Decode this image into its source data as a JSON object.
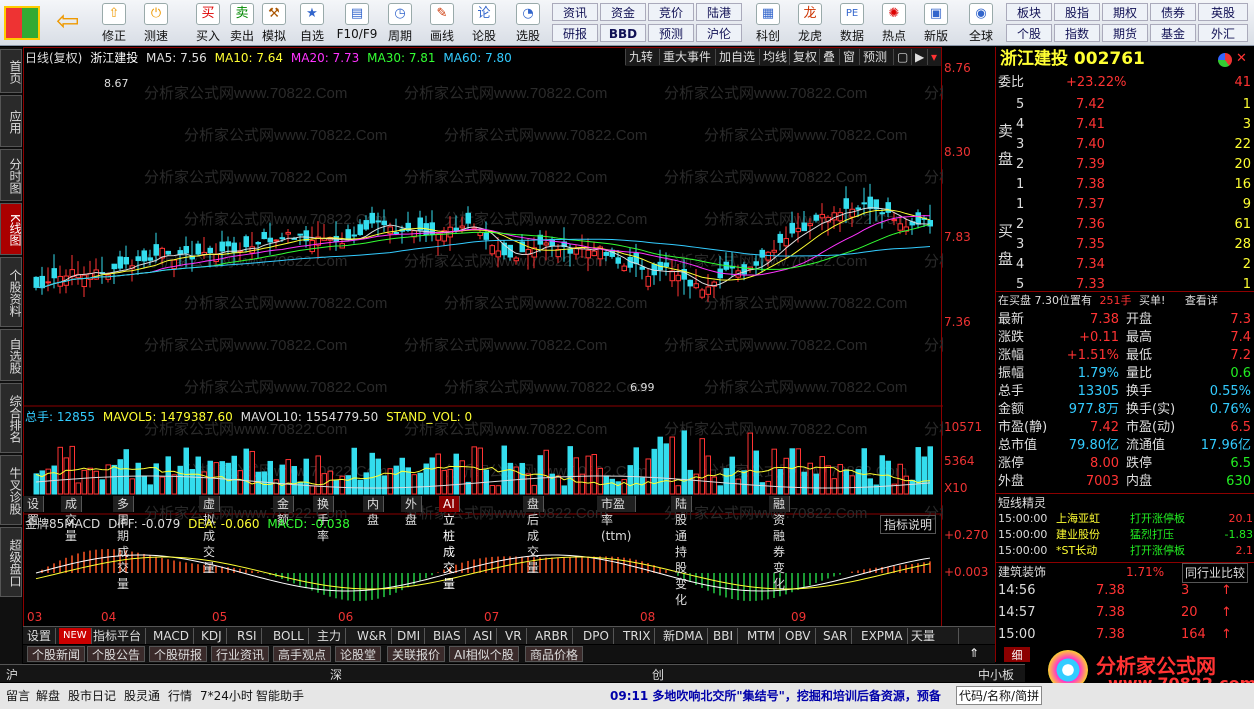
{
  "toolbar": {
    "buttons": [
      "修正",
      "测速",
      "买入",
      "卖出",
      "模拟",
      "自选",
      "F10/F9",
      "周期",
      "画线",
      "论股",
      "选股",
      "科创",
      "龙虎",
      "数据",
      "热点",
      "新版",
      "全球"
    ],
    "small_top": [
      "资讯",
      "资金",
      "竞价",
      "陆港"
    ],
    "small_bottom": [
      "研报",
      "BBD",
      "预测",
      "沪伦"
    ],
    "right_top": [
      "板块",
      "股指",
      "期权",
      "债券",
      "英股"
    ],
    "right_bottom": [
      "个股",
      "指数",
      "期货",
      "基金",
      "外汇"
    ]
  },
  "lefttabs": [
    "首页",
    "应用",
    "分时图",
    "K线图",
    "个股资料",
    "自选股",
    "综合排名",
    "牛叉诊股",
    "超级盘口"
  ],
  "chart_header": {
    "period": "日线(复权)",
    "name": "浙江建投",
    "ma5": "MA5: 7.56",
    "ma10": "MA10: 7.64",
    "ma20": "MA20: 7.73",
    "ma30": "MA30: 7.81",
    "ma60": "MA60: 7.80"
  },
  "chart_buttons": [
    "九转",
    "重大事件",
    "加自选",
    "均线",
    "复权",
    "叠",
    "窗",
    "预测"
  ],
  "price_axis": [
    "8.76",
    "8.30",
    "7.83",
    "7.36"
  ],
  "price_marks": {
    "high": "8.67",
    "low": "6.99"
  },
  "vol_header": {
    "total": "总手: 12855",
    "mavol5": "MAVOL5: 1479387.60",
    "mavol10": "MAVOL10: 1554779.50",
    "stand": "STAND_VOL: 0"
  },
  "vol_axis": [
    "10571",
    "5364",
    "X10"
  ],
  "bottom_tabs": [
    "设置",
    "成交量",
    "多周期成交量",
    "虚拟成交量",
    "金额",
    "换手率",
    "内盘",
    "外盘",
    "AI立桩成交量",
    "盘后成交量",
    "市盈率(ttm)",
    "陆股通持股变化",
    "融资融券变化"
  ],
  "macd_header": {
    "name": "金牌85MACD",
    "diff": "DIFF: -0.079",
    "dea": "DEA: -0.060",
    "macd": "MACD: -0.038",
    "help": "指标说明"
  },
  "macd_axis": [
    "+0.270",
    "+0.003"
  ],
  "months": [
    "03",
    "04",
    "05",
    "06",
    "07",
    "08",
    "09"
  ],
  "indicator_tabs": [
    "设置",
    "NEW",
    "指标平台",
    "MACD",
    "KDJ",
    "RSI",
    "BOLL",
    "主力",
    "W&R",
    "DMI",
    "BIAS",
    "ASI",
    "VR",
    "ARBR",
    "DPO",
    "TRIX",
    "新DMA",
    "BBI",
    "MTM",
    "OBV",
    "SAR",
    "EXPMA",
    "天量和..."
  ],
  "sub_tabs": [
    "个股新闻",
    "个股公告",
    "个股研报",
    "行业资讯",
    "高手观点",
    "论股堂",
    "关联报价",
    "AI相似个股",
    "商品价格"
  ],
  "quote": {
    "title": "浙江建投 002761",
    "weibi_label": "委比",
    "weibi": "+23.22%",
    "weicha": "41",
    "sell": [
      [
        "5",
        "7.42",
        "1"
      ],
      [
        "4",
        "7.41",
        "3"
      ],
      [
        "3",
        "7.40",
        "22"
      ],
      [
        "2",
        "7.39",
        "20"
      ],
      [
        "1",
        "7.38",
        "16"
      ]
    ],
    "buy": [
      [
        "1",
        "7.37",
        "9"
      ],
      [
        "2",
        "7.36",
        "61"
      ],
      [
        "3",
        "7.35",
        "28"
      ],
      [
        "4",
        "7.34",
        "2"
      ],
      [
        "5",
        "7.33",
        "1"
      ]
    ],
    "sell_label": "卖盘",
    "buy_label": "买盘",
    "notice": "在买盘 7.30位置有",
    "notice_qty": "251手",
    "notice_act": "买单!",
    "notice_more": "查看详",
    "stats": [
      [
        "最新",
        "7.38",
        "开盘",
        "7.3"
      ],
      [
        "涨跌",
        "+0.11",
        "最高",
        "7.4"
      ],
      [
        "涨幅",
        "+1.51%",
        "最低",
        "7.2"
      ],
      [
        "振幅",
        "1.79%",
        "量比",
        "0.6"
      ],
      [
        "总手",
        "13305",
        "换手",
        "0.55%"
      ],
      [
        "金额",
        "977.8万",
        "换手(实)",
        "0.76%"
      ],
      [
        "市盈(静)",
        "7.42",
        "市盈(动)",
        "6.5"
      ],
      [
        "总市值",
        "79.80亿",
        "流通值",
        "17.96亿"
      ],
      [
        "涨停",
        "8.00",
        "跌停",
        "6.5"
      ],
      [
        "外盘",
        "7003",
        "内盘",
        "630"
      ]
    ],
    "elf_title": "短线精灵",
    "elf": [
      [
        "15:00:00",
        "上海亚虹",
        "打开涨停板",
        "20.1"
      ],
      [
        "15:00:00",
        "建业股份",
        "猛烈打压",
        "-1.83"
      ],
      [
        "15:00:00",
        "*ST长动",
        "打开涨停板",
        "2.1"
      ]
    ],
    "sector": "建筑装饰",
    "sector_pct": "1.71%",
    "compare": "同行业比较",
    "ticks": [
      [
        "14:56",
        "7.38",
        "3"
      ],
      [
        "14:57",
        "7.38",
        "20"
      ],
      [
        "15:00",
        "7.38",
        "164"
      ]
    ]
  },
  "status": {
    "left": [
      "留言",
      "解盘",
      "股市日记",
      "股灵通",
      "行情",
      "7*24小时",
      "智能助手"
    ],
    "news": "09:11 多地吹响北交所\"集结号\"，挖掘和培训后备资源，预备",
    "right": "代码/名称/简拼",
    "markets": [
      "沪",
      "深",
      "创",
      "中小板指"
    ]
  },
  "watermark": "分析家公式网www.70822.Com",
  "brand": "分析家公式网",
  "brand_url": "www.70822.com"
}
